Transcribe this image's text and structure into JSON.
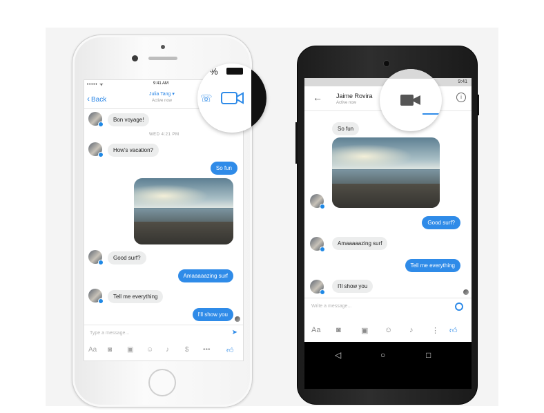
{
  "ios": {
    "status": {
      "carrier": "••••• ᯤ",
      "time": "9:41 AM",
      "battery": "%"
    },
    "nav": {
      "back_label": "Back",
      "title": "Julia Tang ▾",
      "subtitle": "Active now"
    },
    "date_divider": "WED 4:21 PM",
    "messages": [
      {
        "from": "them",
        "text": "Bon voyage!"
      },
      {
        "from": "them",
        "text": "How's vacation?"
      },
      {
        "from": "me",
        "text": "So fun"
      },
      {
        "from": "me",
        "type": "photo"
      },
      {
        "from": "them",
        "text": "Good surf?"
      },
      {
        "from": "me",
        "text": "Amaaaaazing surf"
      },
      {
        "from": "them",
        "text": "Tell me everything"
      },
      {
        "from": "me",
        "text": "I'll show you"
      }
    ],
    "compose_placeholder": "Type a message...",
    "tools": {
      "text": "Aa",
      "more": "•••"
    },
    "magnifier_fragment": "%"
  },
  "android": {
    "status": {
      "time": "9:41"
    },
    "appbar": {
      "name": "Jaime Rovira",
      "subtitle": "Active now"
    },
    "messages": [
      {
        "from": "them",
        "text": "So fun"
      },
      {
        "from": "them",
        "type": "photo"
      },
      {
        "from": "me",
        "text": "Good surf?"
      },
      {
        "from": "them",
        "text": "Amaaaaazing surf"
      },
      {
        "from": "me",
        "text": "Tell me everything"
      },
      {
        "from": "them",
        "text": "I'll show you"
      }
    ],
    "compose_placeholder": "Write a message...",
    "tools": {
      "text": "Aa",
      "more": "⋮"
    }
  },
  "colors": {
    "messenger_blue": "#2f8be8",
    "bubble_grey": "#eceded",
    "android_body": "#1c1c1c"
  },
  "icons": {
    "ios_back": "chevron-left-icon",
    "ios_video": "video-camera-icon",
    "ios_send": "send-icon",
    "ios_tools": [
      "text-format-icon",
      "camera-icon",
      "gallery-icon",
      "emoji-icon",
      "microphone-icon",
      "payment-icon",
      "more-icon",
      "like-icon"
    ],
    "android_video": "video-camera-icon",
    "android_info": "info-icon",
    "android_tools": [
      "text-format-icon",
      "camera-icon",
      "gallery-icon",
      "emoji-icon",
      "microphone-icon",
      "more-icon",
      "like-icon"
    ],
    "android_nav": [
      "back-triangle-icon",
      "home-circle-icon",
      "recents-square-icon"
    ]
  }
}
